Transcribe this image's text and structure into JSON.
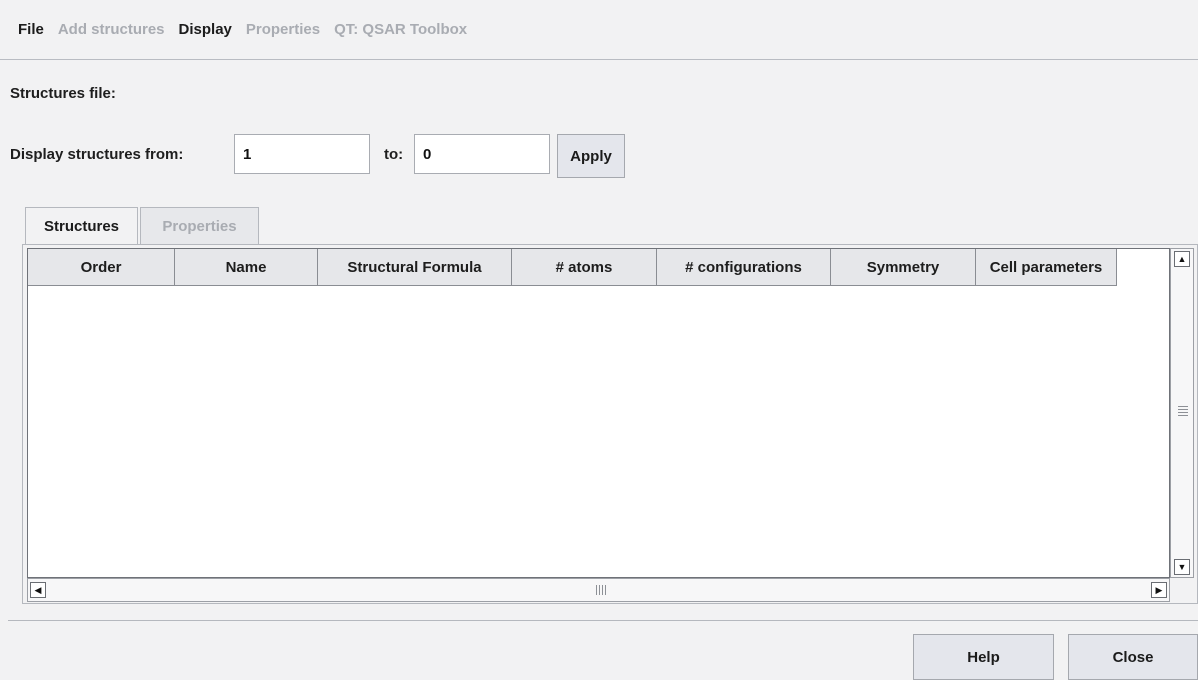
{
  "menubar": {
    "items": [
      {
        "label": "File",
        "enabled": true
      },
      {
        "label": "Add structures",
        "enabled": false
      },
      {
        "label": "Display",
        "enabled": true
      },
      {
        "label": "Properties",
        "enabled": false
      },
      {
        "label": "QT: QSAR Toolbox",
        "enabled": false
      }
    ]
  },
  "structures_file": {
    "label": "Structures file:"
  },
  "range": {
    "from_label": "Display structures from:",
    "from_value": "1",
    "to_label": "to:",
    "to_value": "0",
    "apply_label": "Apply"
  },
  "tabs": [
    {
      "label": "Structures",
      "active": true
    },
    {
      "label": "Properties",
      "active": false
    }
  ],
  "table": {
    "columns": [
      "Order",
      "Name",
      "Structural Formula",
      "# atoms",
      "# configurations",
      "Symmetry",
      "Cell parameters"
    ],
    "rows": []
  },
  "icons": {
    "scroll_up": "arrow-up-icon",
    "scroll_down": "arrow-down-icon",
    "scroll_left": "arrow-left-icon",
    "scroll_right": "arrow-right-icon"
  },
  "footer": {
    "help_label": "Help",
    "close_label": "Close"
  }
}
